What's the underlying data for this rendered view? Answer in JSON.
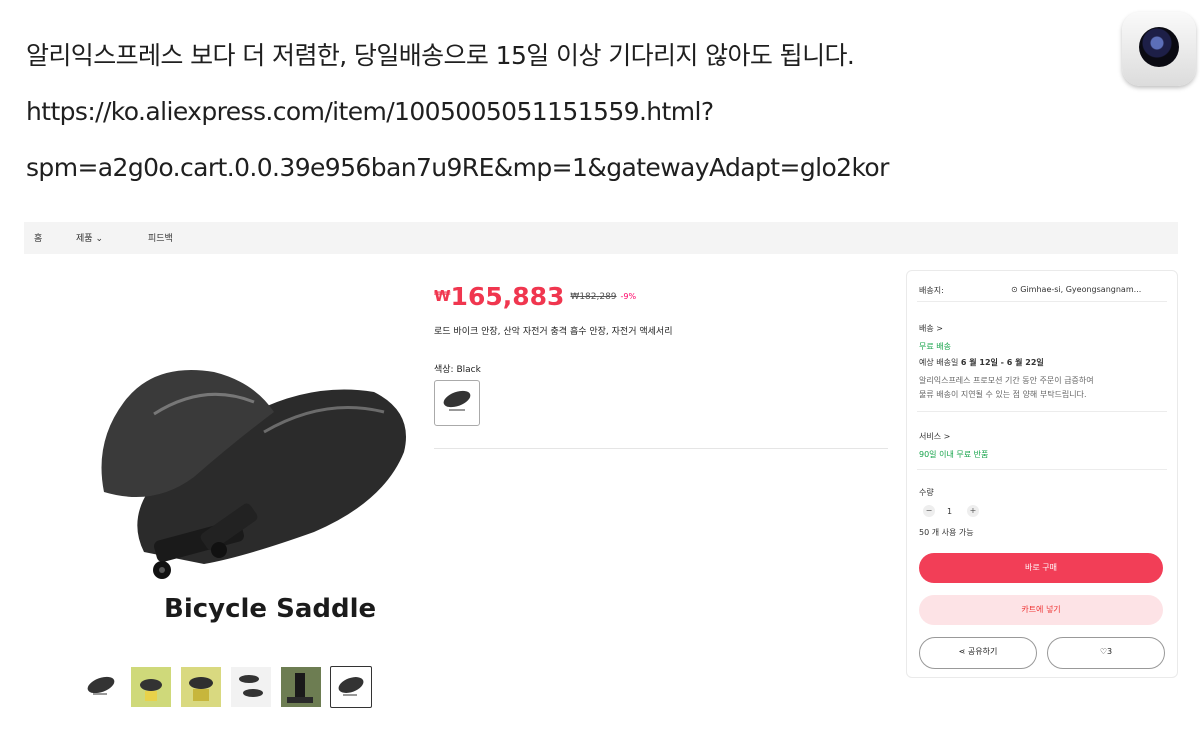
{
  "message": {
    "line1": "알리익스프레스 보다 더 저렴한, 당일배송으로 15일 이상 기다리지 않아도 됩니다.",
    "line2": "https://ko.aliexpress.com/item/1005005051151559.html?",
    "line3": "spm=a2g0o.cart.0.0.39e956ban7u9RE&mp=1&gatewayAdapt=glo2kor"
  },
  "nav": {
    "home": "홈",
    "products": "제품",
    "products_chevron": "⌄",
    "feedback": "피드백"
  },
  "gallery": {
    "caption": "Bicycle Saddle",
    "thumb_count": 6,
    "selected_index": 5
  },
  "product": {
    "currency": "₩",
    "price": "165,883",
    "original_price": "₩182,289",
    "discount": "-9%",
    "title": "로드 바이크 안장, 산악 자전거 충격 흡수 안장, 자전거 액세서리",
    "color_label": "색상: Black"
  },
  "panel": {
    "ship_to_label": "배송지:",
    "ship_to_value": "Gimhae-si, Gyeongsangnam...",
    "shipping_label": "배송 >",
    "free_shipping": "무료 배송",
    "delivery_prefix": "예상 배송일",
    "delivery_dates": "6 월 12일 - 6 월 22일",
    "delivery_note_1": "알리익스프레스 프로모션 기간 동안 주문이 급증하여",
    "delivery_note_2": "물류 배송이 지연될 수 있는 점 양해 부탁드립니다.",
    "service_label": "서비스 >",
    "service_value": "90일 이내 무료 반품",
    "qty_label": "수량",
    "qty_minus": "−",
    "qty_value": "1",
    "qty_plus": "+",
    "available": "50 개 사용 가능",
    "buy_now": "바로 구매",
    "add_cart": "카트에 넣기",
    "share": "공유하기",
    "wishlist_count": "3"
  },
  "colors": {
    "price_red": "#f0364f",
    "buy_button": "#f23e57",
    "cart_button": "#fde3e6",
    "free_green": "#16a34a"
  }
}
